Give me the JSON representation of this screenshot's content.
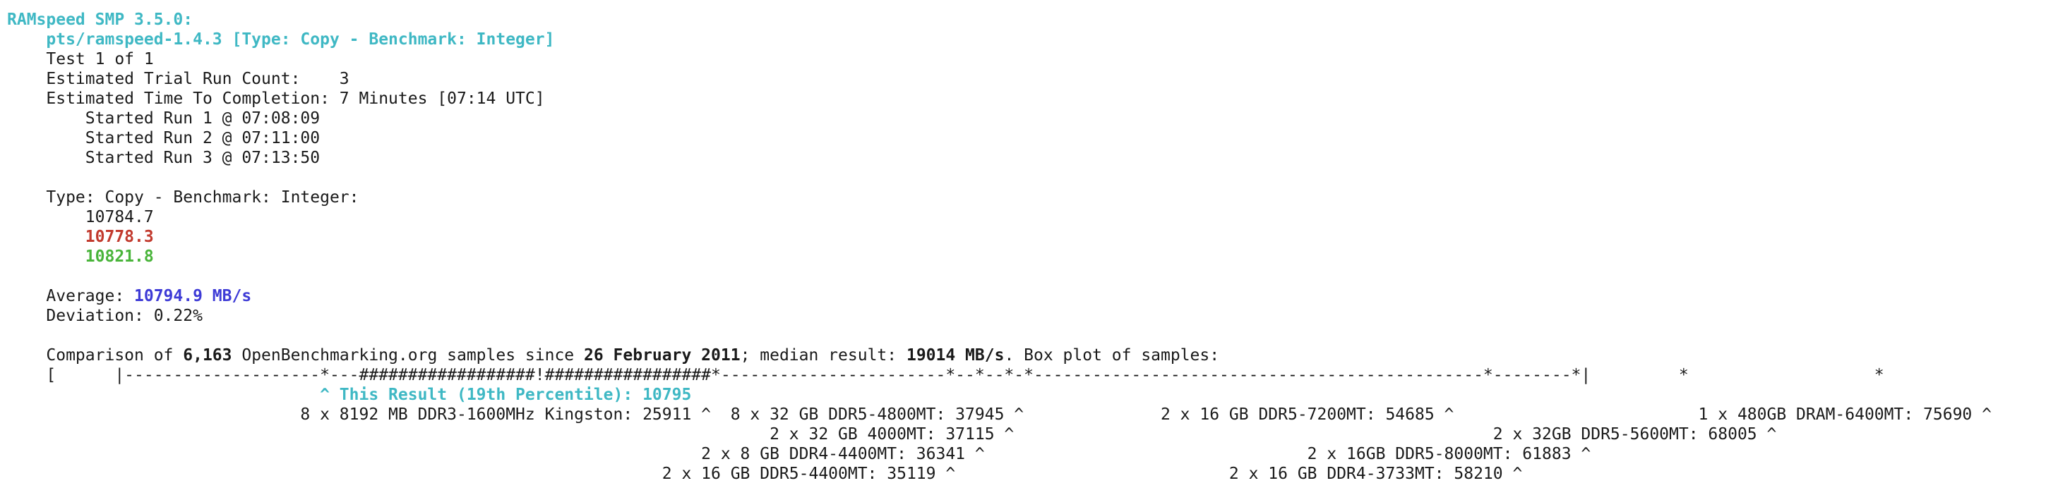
{
  "terminal": {
    "test_title": "RAMspeed SMP 3.5.0:",
    "test_id": "    pts/ramspeed-1.4.3 [Type: Copy - Benchmark: Integer]",
    "test_count": "    Test 1 of 1",
    "trial_count": "    Estimated Trial Run Count:    3",
    "eta": "    Estimated Time To Completion: 7 Minutes [07:14 UTC]",
    "run1": "        Started Run 1 @ 07:08:09",
    "run2": "        Started Run 2 @ 07:11:00",
    "run3": "        Started Run 3 @ 07:13:50",
    "results_header": "    Type: Copy - Benchmark: Integer:",
    "result_values": [
      "10784.7",
      "10778.3",
      "10821.8"
    ],
    "average_label": "    Average: ",
    "average_value": "10794.9 MB/s",
    "deviation": "    Deviation: 0.22%",
    "comparison": {
      "prefix": "    Comparison of ",
      "samples": "6,163",
      "mid1": " OpenBenchmarking.org samples since ",
      "since_date": "26 February 2011",
      "mid2": "; median result: ",
      "median": "19014 MB/s",
      "suffix": ". Box plot of samples:"
    },
    "box_plot": "    [      |--------------------*---##################!#################*-----------------------*--*--*-*----------------------------------------------*--------*|         *                   *                       *      ]",
    "this_result_marker": "                                ^ This Result (19th Percentile): 10795",
    "annotations": [
      "                              8 x 8192 MB DDR3-1600MHz Kingston: 25911 ^  8 x 32 GB DDR5-4800MT: 37945 ^              2 x 16 GB DDR5-7200MT: 54685 ^                         1 x 480GB DRAM-6400MT: 75690 ^",
      "                                                                              2 x 32 GB 4000MT: 37115 ^                                                 2 x 32GB DDR5-5600MT: 68005 ^",
      "                                                                       2 x 8 GB DDR4-4400MT: 36341 ^                                 2 x 16GB DDR5-8000MT: 61883 ^",
      "                                                                   2 x 16 GB DDR5-4400MT: 35119 ^                            2 x 16 GB DDR4-3733MT: 58210 ^"
    ]
  },
  "colors": {
    "accent_cyan": "#3fb8c4",
    "result_red": "#c23a2e",
    "result_green": "#49b43a",
    "average_blue": "#3e3bd6",
    "text": "#1a1a1a",
    "background": "#ffffff"
  }
}
